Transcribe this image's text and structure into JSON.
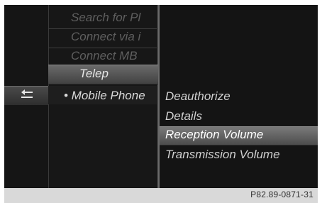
{
  "left_menu": {
    "items": [
      {
        "label": "Search for Pl"
      },
      {
        "label": "Connect via i"
      },
      {
        "label": "Connect MB"
      }
    ],
    "telephone_label": "Telep",
    "mobile_phone_label": "Mobile Phone",
    "mobile_phone_bullet": "•"
  },
  "back": {
    "icon": "back-arrow-icon"
  },
  "submenu": {
    "items": [
      {
        "label": "Deauthorize"
      },
      {
        "label": "Details"
      },
      {
        "label": "Reception Volume"
      },
      {
        "label": "Transmission Volume"
      }
    ],
    "selected_index": 2
  },
  "footer": {
    "reference": "P82.89-0871-31"
  },
  "colors": {
    "background": "#121212",
    "selection": "#6a6a6a",
    "text": "#d9d9d9",
    "dim_text": "#5f5f5f",
    "footer": "#d9d9d9"
  }
}
